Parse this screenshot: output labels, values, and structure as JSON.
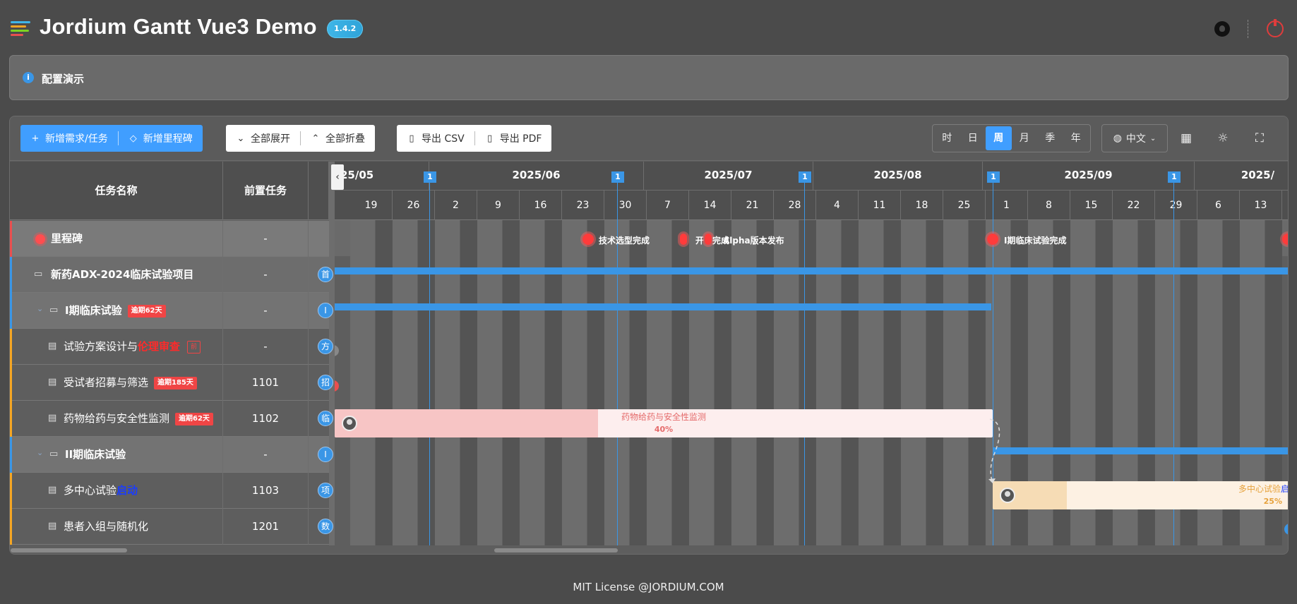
{
  "app": {
    "title": "Jordium Gantt Vue3 Demo",
    "version": "1.4.2",
    "footer": "MIT License @JORDIUM.COM"
  },
  "config": {
    "label": "配置演示"
  },
  "toolbar": {
    "add_task": "新增需求/任务",
    "add_milestone": "新增里程碑",
    "expand_all": "全部展开",
    "collapse_all": "全部折叠",
    "export_csv": "导出 CSV",
    "export_pdf": "导出 PDF",
    "scales": [
      "时",
      "日",
      "周",
      "月",
      "季",
      "年"
    ],
    "active_scale": "周",
    "language": "中文"
  },
  "table": {
    "col_name": "任务名称",
    "col_predecessor": "前置任务",
    "rows": [
      {
        "name": "里程碑",
        "pre": "-",
        "badge": ""
      },
      {
        "name": "新药ADX-2024临床试验项目",
        "pre": "-",
        "circle": "首"
      },
      {
        "name": "I期临床试验",
        "pre": "-",
        "badge": "逾期62天",
        "circle": "I"
      },
      {
        "name_a": "试验方案设计与",
        "name_b": "伦理审查",
        "pre": "-",
        "badge_out": "前",
        "circle": "方"
      },
      {
        "name": "受试者招募与筛选",
        "pre": "1101",
        "badge": "逾期185天",
        "circle": "招"
      },
      {
        "name": "药物给药与安全性监测",
        "pre": "1102",
        "badge": "逾期62天",
        "circle": "临"
      },
      {
        "name": "II期临床试验",
        "pre": "-",
        "circle": "I"
      },
      {
        "name_a": "多中心试验",
        "name_b": "启动",
        "pre": "1103",
        "circle": "项"
      },
      {
        "name": "患者入组与随机化",
        "pre": "1201",
        "circle": "数"
      }
    ]
  },
  "timeline": {
    "months": [
      "25/05",
      "2025/06",
      "2025/07",
      "2025/08",
      "2025/09",
      "2025/"
    ],
    "weeks": [
      "19",
      "26",
      "2",
      "9",
      "16",
      "23",
      "30",
      "7",
      "14",
      "21",
      "28",
      "4",
      "11",
      "18",
      "25",
      "1",
      "8",
      "15",
      "22",
      "29",
      "6",
      "13"
    ],
    "sprint_tag": "1",
    "milestones": [
      {
        "label": "技术选型完成"
      },
      {
        "label": "开"
      },
      {
        "label": "完成"
      },
      {
        "label": "Alpha版本发布"
      },
      {
        "label": "I期临床试验完成"
      }
    ],
    "bar1": {
      "title": "药物给药与安全性监测",
      "progress_label": "40%",
      "progress": 0.4
    },
    "bar2": {
      "title": "多中心试验",
      "title_b": "启",
      "progress_label": "25%",
      "progress": 0.25
    }
  },
  "colors": {
    "accent": "#409eff",
    "danger": "#f04545",
    "bar1_fill": "#f7c5c5",
    "bar2_fill": "#f6dcb5"
  }
}
